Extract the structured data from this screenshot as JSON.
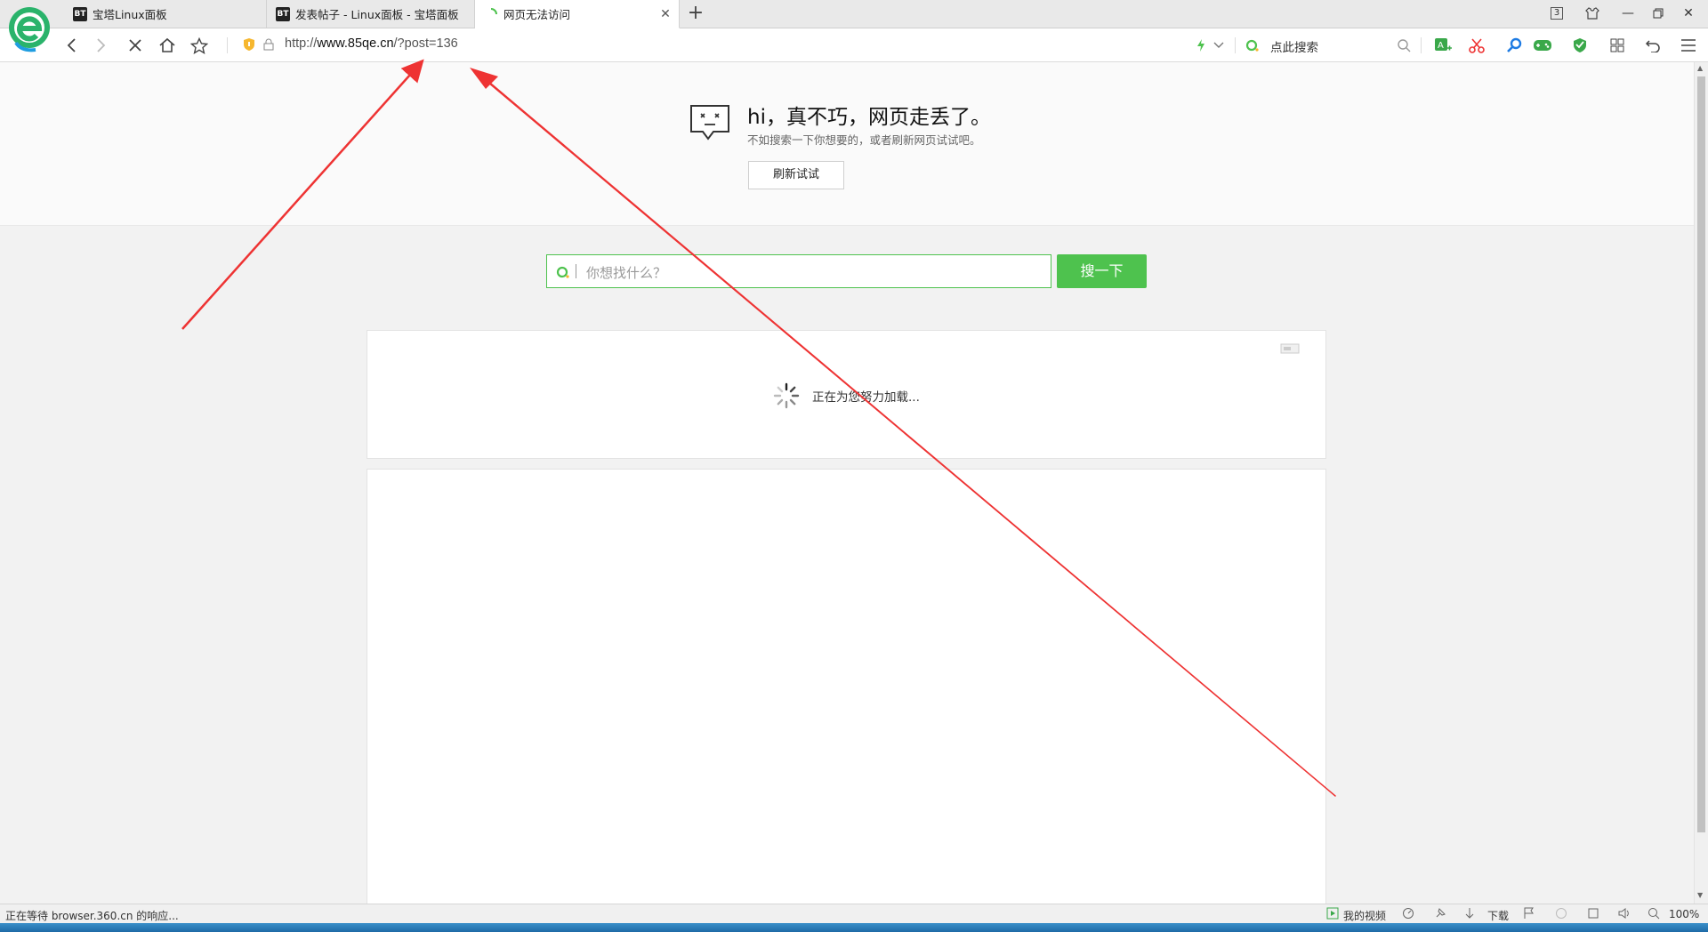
{
  "browser": {
    "tabs": [
      {
        "favicon": "BT",
        "title": "宝塔Linux面板"
      },
      {
        "favicon": "BT",
        "title": "发表帖子 - Linux面板 - 宝塔面板"
      },
      {
        "favicon": "",
        "title": "网页无法访问"
      }
    ],
    "tab_count_badge": "3",
    "url_prefix": "http://",
    "url_host": "www.85qe.cn",
    "url_path": "/?post=136",
    "search_placeholder": "点此搜索"
  },
  "error_page": {
    "headline": "hi，真不巧，网页走丢了。",
    "subtext": "不如搜索一下你想要的，或者刷新网页试试吧。",
    "refresh_button": "刷新试试",
    "search_placeholder": "你想找什么？",
    "search_button": "搜一下",
    "loading_text": "正在为您努力加载..."
  },
  "statusbar": {
    "status_text": "正在等待 browser.360.cn 的响应...",
    "my_video": "我的视频",
    "download": "下载",
    "zoom": "100%"
  },
  "colors": {
    "accent_green": "#4ec24e",
    "annotation_red": "#ee3333"
  }
}
